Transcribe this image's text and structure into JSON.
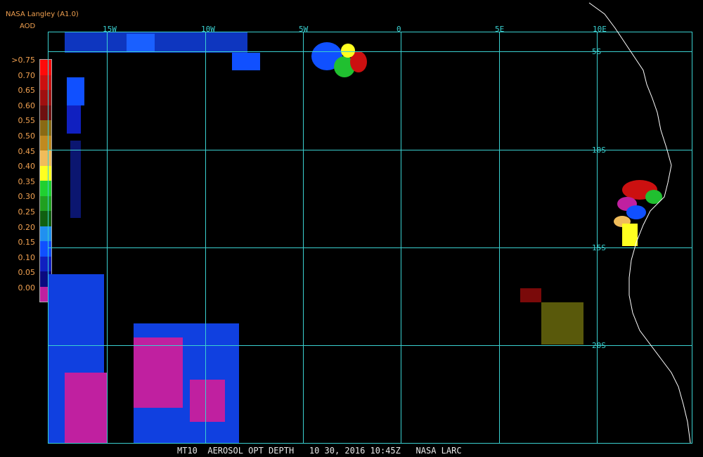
{
  "header": {
    "title": "NASA Langley (A1.0)",
    "variable": "AOD"
  },
  "legend": {
    "labels": [
      ">0.75",
      "0.70",
      "0.65",
      "0.60",
      "0.55",
      "0.50",
      "0.45",
      "0.40",
      "0.35",
      "0.30",
      "0.25",
      "0.20",
      "0.15",
      "0.10",
      "0.05",
      "0.00"
    ],
    "colors": [
      "#ff0a0a",
      "#cc1010",
      "#a01010",
      "#6e1010",
      "#8a6a14",
      "#c08a20",
      "#f0bc5a",
      "#ffff20",
      "#20d030",
      "#20a020",
      "#106010",
      "#2090f0",
      "#1050ff",
      "#1020c0",
      "#0a0a80",
      "#c020a0"
    ]
  },
  "map": {
    "lon_labels": [
      "15W",
      "10W",
      "5W",
      "0",
      "5E",
      "10E"
    ],
    "lat_labels": [
      "5S",
      "10S",
      "15S",
      "20S"
    ],
    "grid_color": "#3ad0d0",
    "coast_color": "#ffffff"
  },
  "footer": {
    "text": "MT10  AEROSOL OPT DEPTH   10 30, 2016 10:45Z   NASA LARC"
  }
}
